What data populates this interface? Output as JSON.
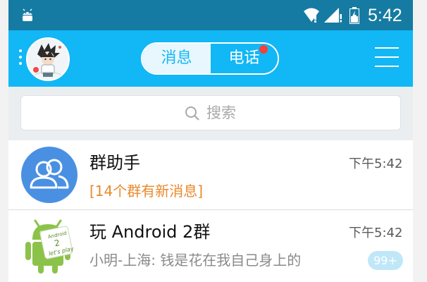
{
  "status_bar": {
    "time": "5:42",
    "icons": [
      "android-icon",
      "wifi-icon",
      "signal-icon",
      "battery-icon"
    ]
  },
  "header": {
    "tabs": [
      {
        "label": "消息",
        "selected": true
      },
      {
        "label": "电话",
        "selected": false,
        "has_badge": true
      }
    ],
    "icons": [
      "more-dots-icon",
      "avatar",
      "menu-icon"
    ]
  },
  "search": {
    "placeholder": "搜索",
    "icon": "search-icon"
  },
  "conversations": [
    {
      "title": "群助手",
      "subtitle": "[14个群有新消息]",
      "time": "下午5:42",
      "avatar_icon": "group-assistant-icon"
    },
    {
      "title": "玩 Android 2群",
      "subtitle": "小明-上海: 钱是花在我自己身上的",
      "time": "下午5:42",
      "unread_badge": "99+",
      "avatar_icon": "android-group-avatar",
      "avatar_text": [
        "Android",
        "2",
        "let's play"
      ]
    }
  ],
  "colors": {
    "status_bar": "#167ba2",
    "header": "#12b7f5",
    "highlight": "#e8892a",
    "badge": "#f4413a"
  }
}
